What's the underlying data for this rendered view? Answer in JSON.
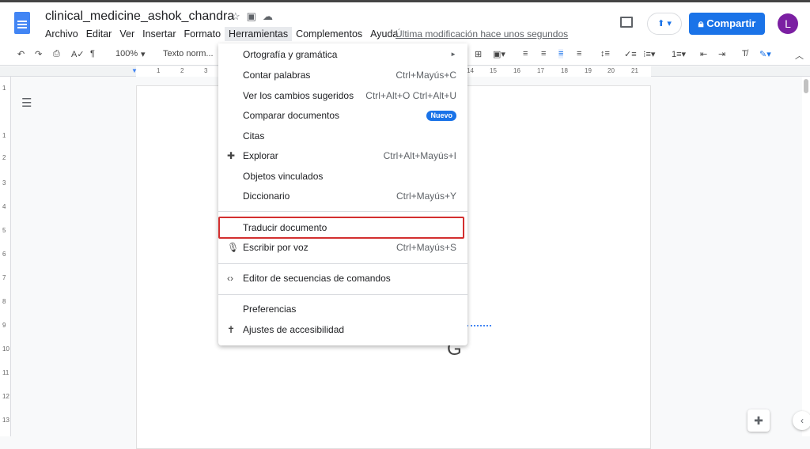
{
  "header": {
    "title": "clinical_medicine_ashok_chandra",
    "last_modified": "Última modificación hace unos segundos",
    "share_label": "Compartir",
    "avatar_letter": "L",
    "menus": [
      "Archivo",
      "Editar",
      "Ver",
      "Insertar",
      "Formato",
      "Herramientas",
      "Complementos",
      "Ayuda"
    ],
    "active_menu": "Herramientas"
  },
  "toolbar": {
    "zoom": "100%",
    "style": "Texto norm..."
  },
  "ruler": {
    "h_ticks": [
      "1",
      "2",
      "3",
      "14",
      "15",
      "16",
      "17",
      "18",
      "19",
      "20",
      "21"
    ],
    "v_ticks": [
      "1",
      "1",
      "2",
      "3",
      "4",
      "5",
      "6",
      "7",
      "8",
      "9",
      "10",
      "11",
      "12",
      "13"
    ]
  },
  "doc": {
    "glyph": "G"
  },
  "tools_menu": {
    "items": [
      {
        "label": "Ortografía y gramática",
        "shortcut": "►"
      },
      {
        "label": "Contar palabras",
        "shortcut": "Ctrl+Mayús+C"
      },
      {
        "label": "Ver los cambios sugeridos",
        "shortcut": "Ctrl+Alt+O Ctrl+Alt+U"
      },
      {
        "label": "Comparar documentos",
        "badge": "Nuevo"
      },
      {
        "label": "Citas"
      },
      {
        "label": "Explorar",
        "shortcut": "Ctrl+Alt+Mayús+I"
      },
      {
        "label": "Objetos vinculados"
      },
      {
        "label": "Diccionario",
        "shortcut": "Ctrl+Mayús+Y"
      },
      {
        "label": "Traducir documento"
      },
      {
        "label": "Escribir por voz",
        "shortcut": "Ctrl+Mayús+S"
      },
      {
        "label": "Editor de secuencias de comandos"
      },
      {
        "label": "Preferencias"
      },
      {
        "label": "Ajustes de accesibilidad"
      }
    ],
    "highlight_color": "#d32f2f"
  }
}
